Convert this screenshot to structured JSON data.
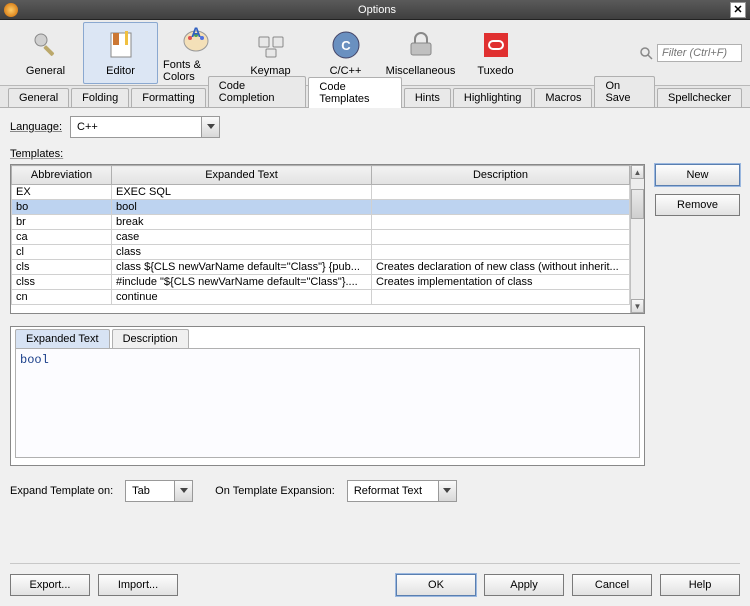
{
  "window": {
    "title": "Options"
  },
  "search": {
    "placeholder": "Filter (Ctrl+F)"
  },
  "toolbar": {
    "items": [
      {
        "label": "General"
      },
      {
        "label": "Editor"
      },
      {
        "label": "Fonts & Colors"
      },
      {
        "label": "Keymap"
      },
      {
        "label": "C/C++"
      },
      {
        "label": "Miscellaneous"
      },
      {
        "label": "Tuxedo"
      }
    ]
  },
  "tabs": [
    "General",
    "Folding",
    "Formatting",
    "Code Completion",
    "Code Templates",
    "Hints",
    "Highlighting",
    "Macros",
    "On Save",
    "Spellchecker"
  ],
  "language": {
    "label": "Language:",
    "value": "C++"
  },
  "templates_label": "Templates:",
  "columns": [
    "Abbreviation",
    "Expanded Text",
    "Description"
  ],
  "rows": [
    {
      "abbr": "EX",
      "exp": "EXEC SQL",
      "desc": ""
    },
    {
      "abbr": "bo",
      "exp": "bool",
      "desc": ""
    },
    {
      "abbr": "br",
      "exp": "break",
      "desc": ""
    },
    {
      "abbr": "ca",
      "exp": "case",
      "desc": ""
    },
    {
      "abbr": "cl",
      "exp": "class",
      "desc": ""
    },
    {
      "abbr": "cls",
      "exp": "class ${CLS newVarName default=\"Class\"} {pub...",
      "desc": "Creates declaration of new class (without inherit..."
    },
    {
      "abbr": "clss",
      "exp": "#include \"${CLS newVarName default=\"Class\"}....",
      "desc": "Creates implementation of class"
    },
    {
      "abbr": "cn",
      "exp": "continue",
      "desc": ""
    }
  ],
  "side_buttons": {
    "new": "New",
    "remove": "Remove"
  },
  "editor_tabs": [
    "Expanded Text",
    "Description"
  ],
  "editor_content": "bool",
  "expand_template": {
    "label": "Expand Template on:",
    "value": "Tab"
  },
  "on_expansion": {
    "label": "On Template Expansion:",
    "value": "Reformat Text"
  },
  "bottom": {
    "export": "Export...",
    "import": "Import...",
    "ok": "OK",
    "apply": "Apply",
    "cancel": "Cancel",
    "help": "Help"
  }
}
